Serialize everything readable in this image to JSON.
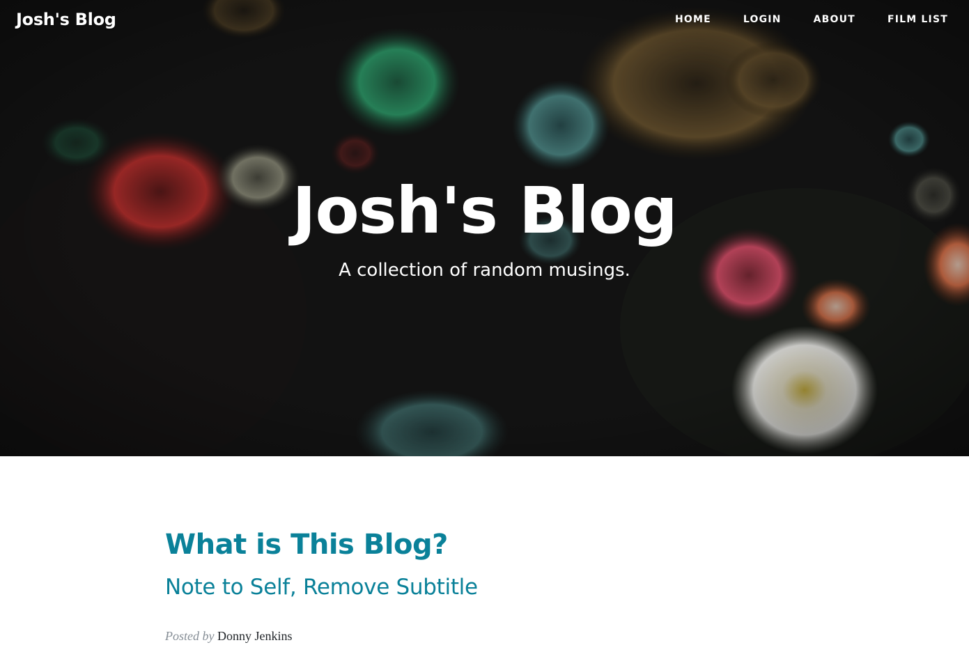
{
  "navbar": {
    "brand": "Josh's Blog",
    "links": [
      "HOME",
      "LOGIN",
      "ABOUT",
      "FILM LIST"
    ]
  },
  "hero": {
    "title": "Josh's Blog",
    "subtitle": "A collection of random musings."
  },
  "post": {
    "title": "What is This Blog?",
    "subtitle": "Note to Self, Remove Subtitle",
    "meta_prefix": "Posted by",
    "author": "Donny Jenkins"
  },
  "colors": {
    "accent": "#0a8199",
    "hero_background": "#151515"
  }
}
